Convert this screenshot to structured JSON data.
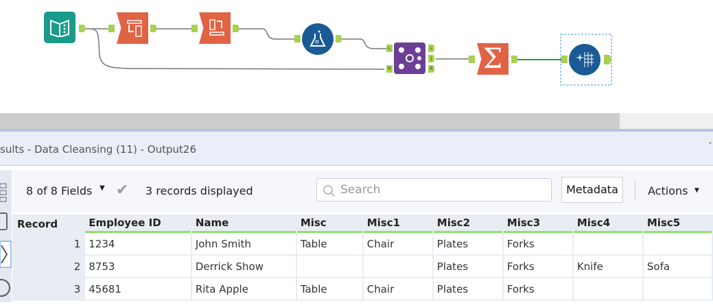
{
  "workflow": {
    "tools": [
      {
        "name": "Input Data",
        "icon": "book-icon",
        "color": "#1a9b8a"
      },
      {
        "name": "Transpose",
        "icon": "transpose-icon",
        "color": "#e06346"
      },
      {
        "name": "Cross Tab",
        "icon": "crosstab-icon",
        "color": "#e06346"
      },
      {
        "name": "Data Cleansing",
        "icon": "flask-icon",
        "color": "#1b5b95"
      },
      {
        "name": "Join",
        "icon": "join-icon",
        "color": "#6b3f96",
        "anchors": [
          "L",
          "J",
          "R"
        ]
      },
      {
        "name": "Summarize",
        "icon": "sigma-icon",
        "color": "#e06346"
      },
      {
        "name": "Browse",
        "icon": "browse-icon",
        "color": "#1b5b95"
      }
    ]
  },
  "results": {
    "title": "sults - Data Cleansing (11) - Output26",
    "fields_label": "8 of 8 Fields",
    "records_label": "3 records displayed",
    "search_placeholder": "Search",
    "metadata_label": "Metadata",
    "actions_label": "Actions"
  },
  "table": {
    "columns": [
      "Record",
      "Employee ID",
      "Name",
      "Misc",
      "Misc1",
      "Misc2",
      "Misc3",
      "Misc4",
      "Misc5"
    ],
    "rows": [
      [
        "1",
        "1234",
        "John Smith",
        "Table",
        "Chair",
        "Plates",
        "Forks",
        "",
        ""
      ],
      [
        "2",
        "8753",
        "Derrick Show",
        "",
        "",
        "Plates",
        "Forks",
        "Knife",
        "Sofa"
      ],
      [
        "3",
        "45681",
        "Rita Apple",
        "Table",
        "Chair",
        "Plates",
        "Forks",
        "",
        ""
      ]
    ]
  }
}
